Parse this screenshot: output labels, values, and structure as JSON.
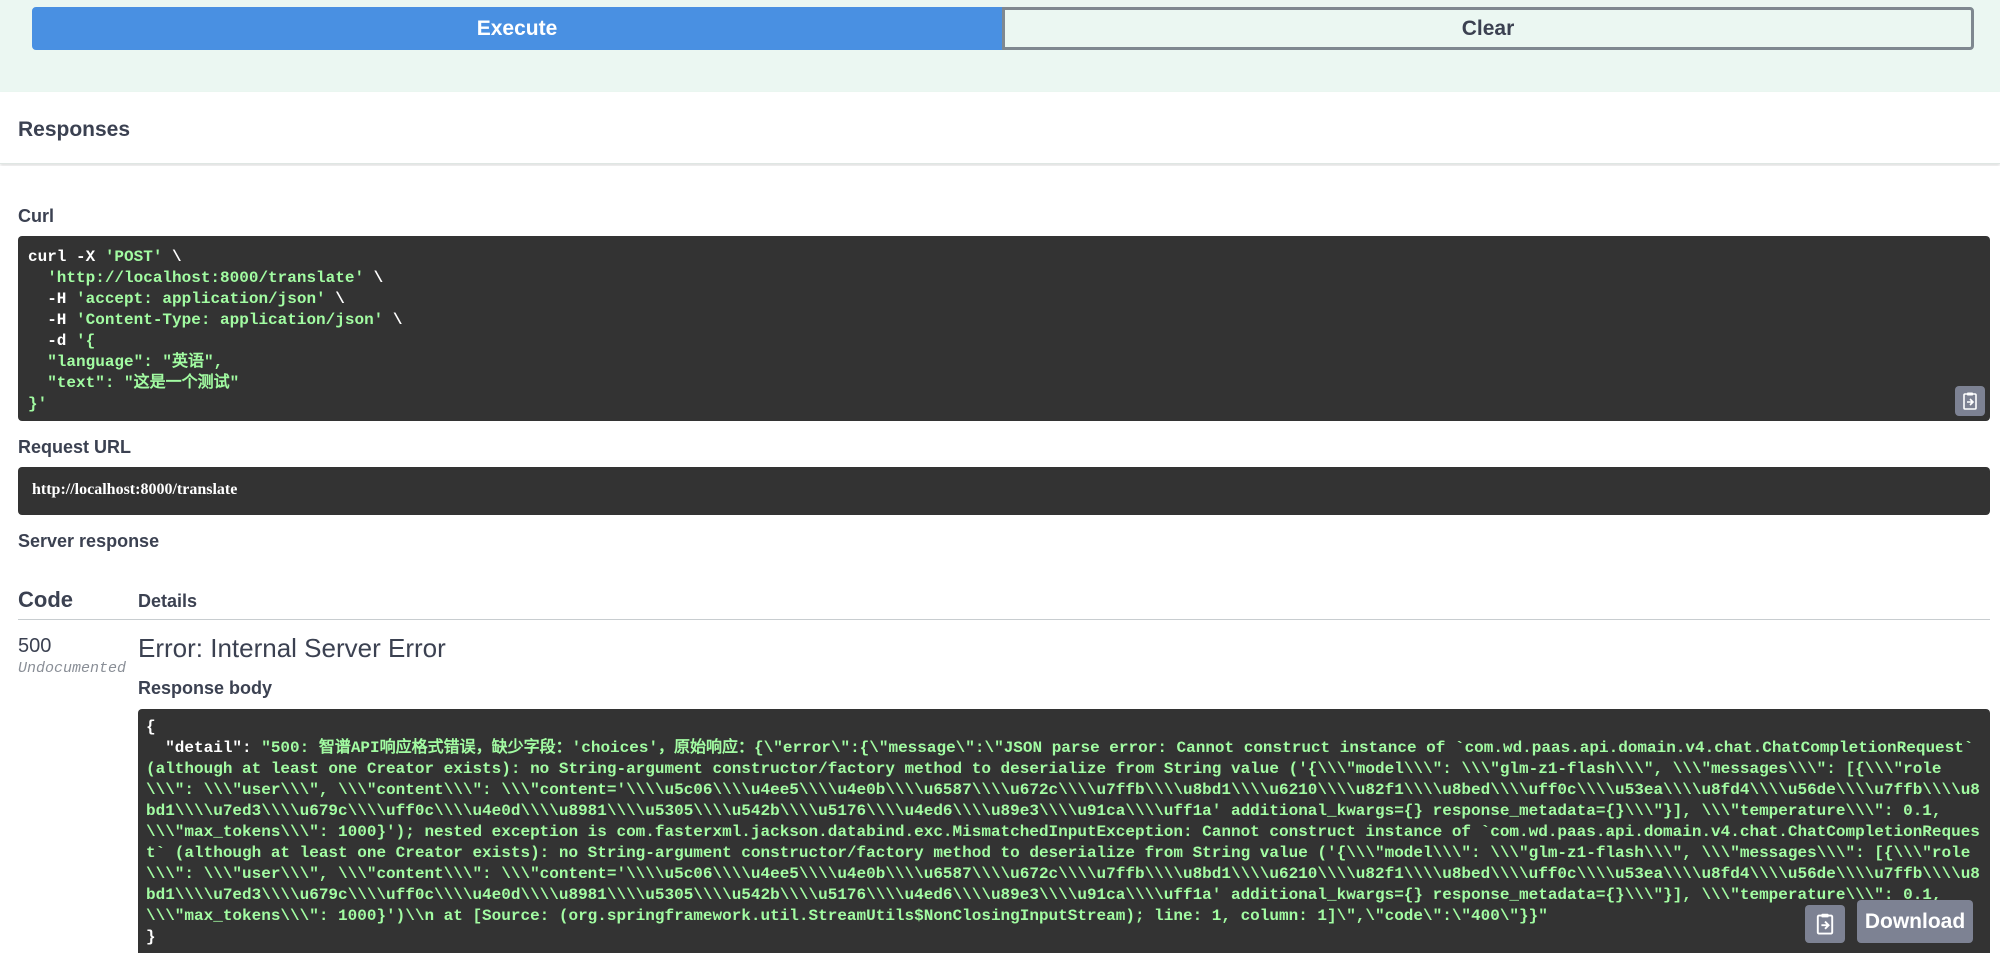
{
  "actions": {
    "execute_label": "Execute",
    "clear_label": "Clear"
  },
  "responses_title": "Responses",
  "curl": {
    "label": "Curl",
    "line1_cmd": "curl -X ",
    "line1_method": "'POST'",
    "line1_tail": " \\",
    "line2_url": "'http://localhost:8000/translate'",
    "line3_flag": "-H ",
    "line3_value": "'accept: application/json'",
    "line4_flag": "-H ",
    "line4_value": "'Content-Type: application/json'",
    "line5_flag": "-d ",
    "line5_value": "'{",
    "line6": "\"language\": \"英语\",",
    "line7": "\"text\": \"这是一个测试\"",
    "line8": "}'"
  },
  "request_url": {
    "label": "Request URL",
    "value": "http://localhost:8000/translate"
  },
  "server_response": {
    "label": "Server response",
    "col_code": "Code",
    "col_details": "Details",
    "code": "500",
    "code_note": "Undocumented",
    "error_title": "Error: Internal Server Error",
    "body_label": "Response body",
    "body_open": "{",
    "body_key": "\"detail\"",
    "body_sep": ": ",
    "body_value": "\"500: 智谱API响应格式错误，缺少字段：'choices'，原始响应：{\\\"error\\\":{\\\"message\\\":\\\"JSON parse error: Cannot construct instance of `com.wd.paas.api.domain.v4.chat.ChatCompletionRequest` (although at least one Creator exists): no String-argument constructor/factory method to deserialize from String value ('{\\\\\\\"model\\\\\\\": \\\\\\\"glm-z1-flash\\\\\\\", \\\\\\\"messages\\\\\\\": [{\\\\\\\"role\\\\\\\": \\\\\\\"user\\\\\\\", \\\\\\\"content\\\\\\\": \\\\\\\"content='\\\\\\\\u5c06\\\\\\\\u4ee5\\\\\\\\u4e0b\\\\\\\\u6587\\\\\\\\u672c\\\\\\\\u7ffb\\\\\\\\u8bd1\\\\\\\\u6210\\\\\\\\u82f1\\\\\\\\u8bed\\\\\\\\uff0c\\\\\\\\u53ea\\\\\\\\u8fd4\\\\\\\\u56de\\\\\\\\u7ffb\\\\\\\\u8bd1\\\\\\\\u7ed3\\\\\\\\u679c\\\\\\\\uff0c\\\\\\\\u4e0d\\\\\\\\u8981\\\\\\\\u5305\\\\\\\\u542b\\\\\\\\u5176\\\\\\\\u4ed6\\\\\\\\u89e3\\\\\\\\u91ca\\\\\\\\uff1a' additional_kwargs={} response_metadata={}\\\\\\\"}], \\\\\\\"temperature\\\\\\\": 0.1, \\\\\\\"max_tokens\\\\\\\": 1000}'); nested exception is com.fasterxml.jackson.databind.exc.MismatchedInputException: Cannot construct instance of `com.wd.paas.api.domain.v4.chat.ChatCompletionRequest` (although at least one Creator exists): no String-argument constructor/factory method to deserialize from String value ('{\\\\\\\"model\\\\\\\": \\\\\\\"glm-z1-flash\\\\\\\", \\\\\\\"messages\\\\\\\": [{\\\\\\\"role\\\\\\\": \\\\\\\"user\\\\\\\", \\\\\\\"content\\\\\\\": \\\\\\\"content='\\\\\\\\u5c06\\\\\\\\u4ee5\\\\\\\\u4e0b\\\\\\\\u6587\\\\\\\\u672c\\\\\\\\u7ffb\\\\\\\\u8bd1\\\\\\\\u6210\\\\\\\\u82f1\\\\\\\\u8bed\\\\\\\\uff0c\\\\\\\\u53ea\\\\\\\\u8fd4\\\\\\\\u56de\\\\\\\\u7ffb\\\\\\\\u8bd1\\\\\\\\u7ed3\\\\\\\\u679c\\\\\\\\uff0c\\\\\\\\u4e0d\\\\\\\\u8981\\\\\\\\u5305\\\\\\\\u542b\\\\\\\\u5176\\\\\\\\u4ed6\\\\\\\\u89e3\\\\\\\\u91ca\\\\\\\\uff1a' additional_kwargs={} response_metadata={}\\\\\\\"}], \\\\\\\"temperature\\\\\\\": 0.1, \\\\\\\"max_tokens\\\\\\\": 1000}')\\\\n at [Source: (org.springframework.util.StreamUtils$NonClosingInputStream); line: 1, column: 1]\\\",\\\"code\\\":\\\"400\\\"}}\"",
    "body_close": "}",
    "download_label": "Download"
  },
  "icons": {
    "copy": "clipboard-copy-icon"
  },
  "colors": {
    "execute_bg": "#4990e2",
    "band_bg": "#ebf7f2",
    "code_bg": "#333333",
    "string_green": "#a2fca2"
  }
}
